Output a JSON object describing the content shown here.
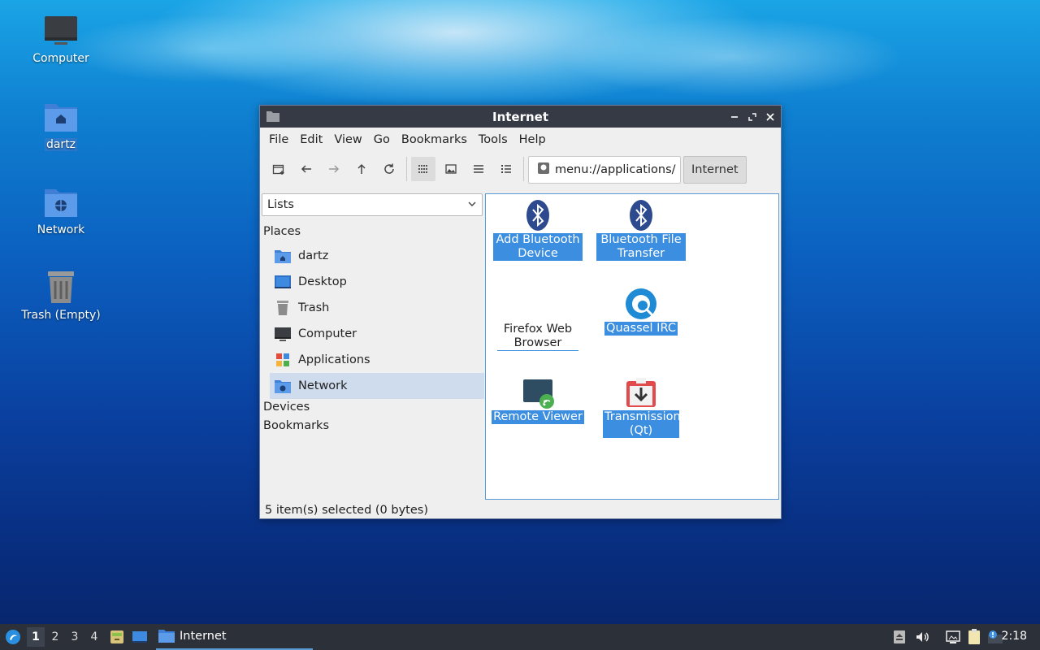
{
  "desktop": {
    "icons": [
      {
        "label": "Computer"
      },
      {
        "label": "dartz"
      },
      {
        "label": "Network"
      },
      {
        "label": "Trash (Empty)"
      }
    ]
  },
  "window": {
    "title": "Internet",
    "menu": [
      "File",
      "Edit",
      "View",
      "Go",
      "Bookmarks",
      "Tools",
      "Help"
    ],
    "path": "menu://applications/",
    "breadcrumb": "Internet",
    "side": {
      "dropdown": "Lists",
      "places_header": "Places",
      "places": [
        {
          "label": "dartz",
          "icon": "home-folder-icon"
        },
        {
          "label": "Desktop",
          "icon": "desktop-icon"
        },
        {
          "label": "Trash",
          "icon": "trash-icon"
        },
        {
          "label": "Computer",
          "icon": "computer-icon"
        },
        {
          "label": "Applications",
          "icon": "applications-icon"
        },
        {
          "label": "Network",
          "icon": "network-folder-icon"
        }
      ],
      "devices_header": "Devices",
      "bookmarks_header": "Bookmarks"
    },
    "apps": [
      {
        "label": "Add Bluetooth Device",
        "icon": "bluetooth-icon"
      },
      {
        "label": "Bluetooth File Transfer",
        "icon": "bluetooth-icon"
      },
      {
        "label": "Firefox Web Browser",
        "icon": "firefox-icon"
      },
      {
        "label": "Quassel IRC",
        "icon": "quassel-icon"
      },
      {
        "label": "Remote Viewer",
        "icon": "remote-viewer-icon"
      },
      {
        "label": "Transmission (Qt)",
        "icon": "transmission-icon"
      }
    ],
    "status": "5 item(s) selected (0 bytes)"
  },
  "taskbar": {
    "workspaces": [
      "1",
      "2",
      "3",
      "4"
    ],
    "task_label": "Internet",
    "clock": "2:18"
  },
  "colors": {
    "selection": "#3b8ee0",
    "titlebar": "#353a44",
    "taskbar": "#2c3038"
  }
}
